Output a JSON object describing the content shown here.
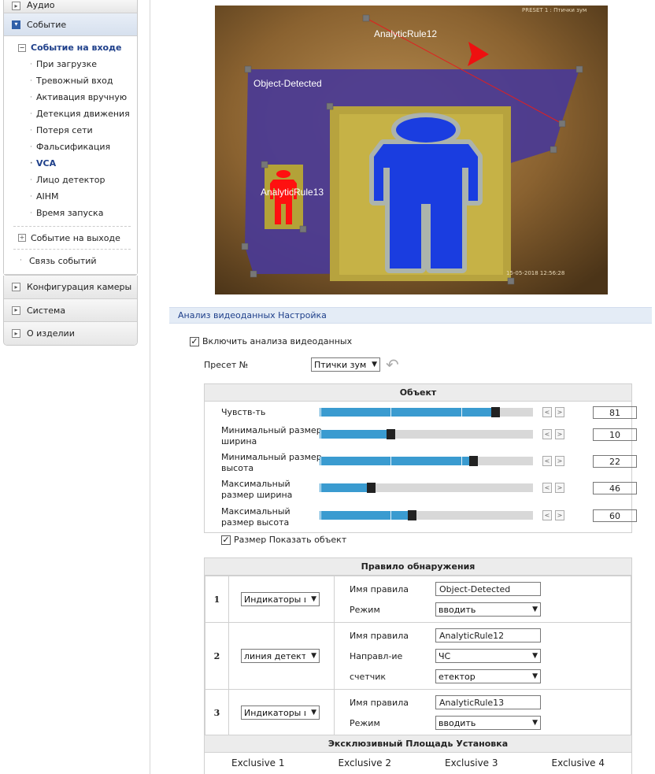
{
  "sidebar": {
    "audio": "Аудио",
    "event": "Событие",
    "event_in": "Событие на входе",
    "sub_items": [
      "При загрузке",
      "Тревожный вход",
      "Активация вручную",
      "Детекция движения",
      "Потеря сети",
      "Фальсификация",
      "VCA",
      "Лицо детектор",
      "AIHM",
      "Время запуска"
    ],
    "current_sub": "VCA",
    "event_out": "Событие на выходе",
    "event_link": "Связь событий",
    "camera_config": "Конфигурация камеры",
    "system": "Система",
    "about": "О изделии"
  },
  "video": {
    "osd_top": "PRESET 1 : Птички зум",
    "osd_timestamp": "15-05-2018 12:56:28",
    "rule_object_detected": "Object-Detected",
    "rule_12": "AnalyticRule12",
    "rule_13": "AnalyticRule13"
  },
  "settings": {
    "header": "Анализ видеоданных Настройка",
    "enable_label": "Включить анализа видеоданных",
    "enable_checked": true,
    "preset_label": "Пресет №",
    "preset_value": "Птички зум"
  },
  "object_panel": {
    "title": "Объект",
    "sliders": [
      {
        "label_1": "Чувств-ть",
        "label_2": "",
        "value": "81",
        "level": 81
      },
      {
        "label_1": "Минимальный размер",
        "label_2": "ширина",
        "value": "10",
        "level": 32
      },
      {
        "label_1": "Минимальный размер",
        "label_2": "высота",
        "value": "22",
        "level": 71
      },
      {
        "label_1": "Максимальный",
        "label_2": "размер ширина",
        "value": "46",
        "level": 23
      },
      {
        "label_1": "Максимальный",
        "label_2": "размер высота",
        "value": "60",
        "level": 42
      }
    ],
    "step_left": "<",
    "step_right": ">",
    "show_size_label": "Размер Показать объект",
    "show_size_checked": true
  },
  "rules_panel": {
    "title": "Правило обнаружения",
    "rules": [
      {
        "num": "1",
        "type": "Индикаторы и",
        "name_label": "Имя правила",
        "name": "Object-Detected",
        "f2_label": "Режим",
        "f2_value": "вводить"
      },
      {
        "num": "2",
        "type": "линия детект",
        "name_label": "Имя правила",
        "name": "AnalyticRule12",
        "f2_label": "Направл-ие",
        "f2_value": "ЧС",
        "f3_label": "счетчик",
        "f3_value": "етектор"
      },
      {
        "num": "3",
        "type": "Индикаторы и",
        "name_label": "Имя правила",
        "name": "AnalyticRule13",
        "f2_label": "Режим",
        "f2_value": "вводить"
      }
    ]
  },
  "exclusive_panel": {
    "title": "Эксклюзивный Площадь Установка",
    "columns": [
      "Exclusive 1",
      "Exclusive 2",
      "Exclusive 3",
      "Exclusive 4"
    ]
  },
  "colors": {
    "accent_blue": "#1e3f8a",
    "slider_fill": "#3a9bd0",
    "zone_purple": "#4a3a94",
    "person_blue": "#1a3de0",
    "person_red": "#ff1010"
  }
}
